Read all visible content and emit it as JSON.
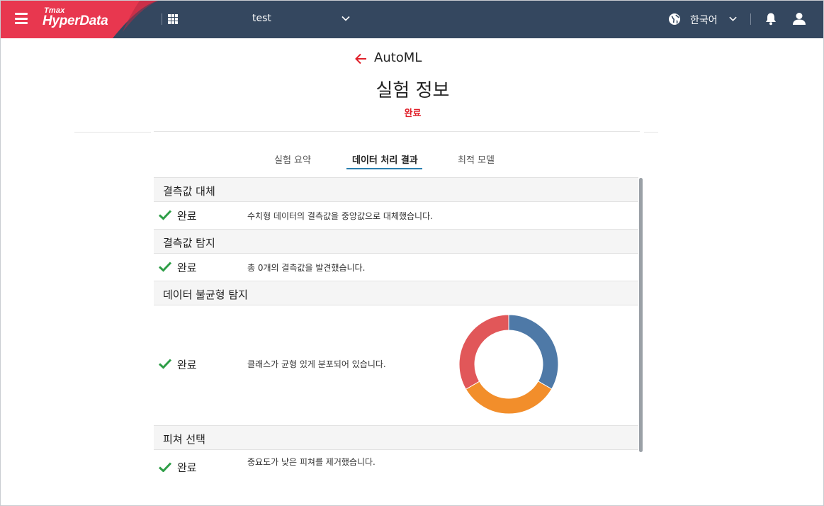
{
  "topbar": {
    "logo_small": "Tmax",
    "logo_big": "HyperData",
    "project": "test",
    "language": "한국어",
    "icons": [
      "menu-icon",
      "apps-grid-icon",
      "chevron-down-icon",
      "globe-icon",
      "bell-icon",
      "user-icon"
    ]
  },
  "header": {
    "back_label": "AutoML",
    "title": "실험 정보",
    "status": "완료"
  },
  "tabs": [
    {
      "label": "실험 요약",
      "active": false
    },
    {
      "label": "데이터 처리 결과",
      "active": true
    },
    {
      "label": "최적 모델",
      "active": false
    }
  ],
  "sections": [
    {
      "title": "결측값 대체",
      "status": "완료",
      "description": "수치형 데이터의 결측값을 중앙값으로 대체했습니다."
    },
    {
      "title": "결측값 탐지",
      "status": "완료",
      "description": "총 0개의 결측값을 발견했습니다."
    },
    {
      "title": "데이터 불균형 탐지",
      "status": "완료",
      "description": "클래스가 균형 있게 분포되어 있습니다."
    },
    {
      "title": "피쳐 선택",
      "status": "완료",
      "description": "중요도가 낮은 피쳐를 제거했습니다."
    }
  ],
  "colors": {
    "topbar": "#34475f",
    "brand": "#e8374f",
    "status_red": "#e0202a",
    "check_green": "#2e9e47",
    "tab_underline": "#2a7fb0"
  },
  "chart_data": {
    "type": "pie",
    "donut": true,
    "categories": [
      "",
      "",
      ""
    ],
    "values": [
      0.333,
      0.333,
      0.334
    ],
    "colors": [
      "#4e79a7",
      "#f28e2b",
      "#e15759"
    ],
    "title": ""
  }
}
